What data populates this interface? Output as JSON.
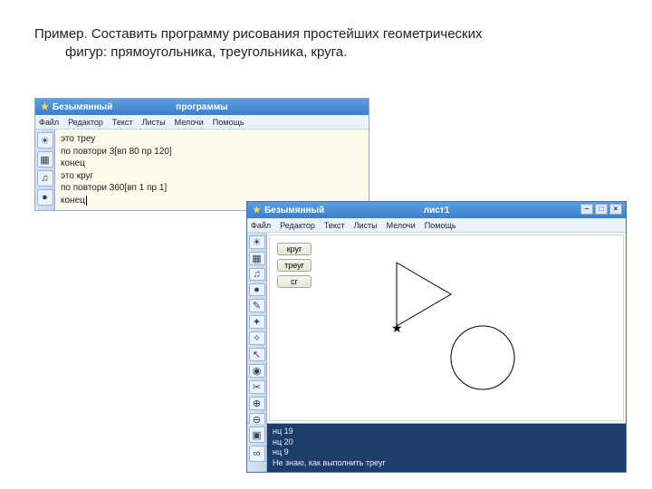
{
  "task": {
    "line1": "Пример. Составить программу рисования простейших геометрических",
    "line2": "фигур: прямоугольника, треугольника, круга."
  },
  "win1": {
    "title_main": "Безымянный",
    "title_sub": "программы",
    "menu": [
      "Файл",
      "Редактор",
      "Текст",
      "Листы",
      "Мелочи",
      "Помощь"
    ],
    "tools": [
      "turtle-icon",
      "blocks-icon",
      "music-icon",
      "mic-icon"
    ],
    "code": "это треу\nпо повтори 3[вп 80 пр 120]\nконец\nэто круг\nпо повтори 360[вп 1 пр 1]\nконец"
  },
  "win2": {
    "title_main": "Безымянный",
    "title_sub": "лист1",
    "menu": [
      "Файл",
      "Редактор",
      "Текст",
      "Листы",
      "Мелочи",
      "Помощь"
    ],
    "tools_left": [
      "turtle-icon",
      "blocks-icon",
      "music-icon",
      "mic-icon",
      "paint-icon",
      "camera-icon",
      "wand-icon",
      "arrow-icon",
      "eye-icon",
      "scissors-icon",
      "zoom-in-icon",
      "zoom-out-icon"
    ],
    "canvas_buttons": [
      "круг",
      "треуг",
      "сг"
    ],
    "bottom_tools": [
      "run-icon",
      "link-icon"
    ],
    "console": "нц 19\nнц 20\nнц 9\nНе знаю, как выполнить треуг"
  },
  "icons": {
    "turtle-icon": "☀",
    "blocks-icon": "▦",
    "music-icon": "♫",
    "mic-icon": "●",
    "paint-icon": "✎",
    "camera-icon": "✦",
    "wand-icon": "✧",
    "arrow-icon": "↖",
    "eye-icon": "◉",
    "scissors-icon": "✂",
    "zoom-in-icon": "⊕",
    "zoom-out-icon": "⊖",
    "run-icon": "▣",
    "link-icon": "∞"
  }
}
